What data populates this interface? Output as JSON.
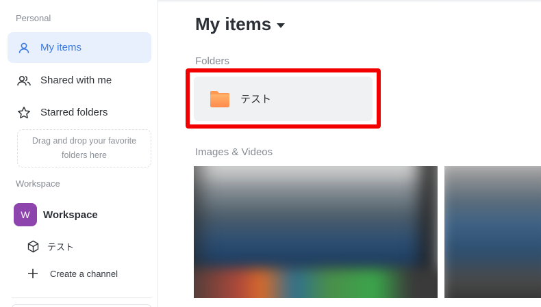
{
  "sidebar": {
    "personal_label": "Personal",
    "items": [
      {
        "label": "My items",
        "icon": "user-icon",
        "active": true
      },
      {
        "label": "Shared with me",
        "icon": "users-icon",
        "active": false
      },
      {
        "label": "Starred folders",
        "icon": "star-icon",
        "active": false
      }
    ],
    "drop_zone_text": "Drag and drop your favorite\nfolders here",
    "workspace_label": "Workspace",
    "workspace": {
      "avatar": "W",
      "name": "Workspace",
      "avatar_color": "#8e44ad"
    },
    "channels": [
      {
        "label": "テスト",
        "icon": "cube-icon"
      }
    ],
    "create_channel_label": "Create a channel"
  },
  "main": {
    "title": "My items",
    "folders_label": "Folders",
    "folders": [
      {
        "name": "テスト",
        "icon": "folder-icon",
        "color": "#ff9f5a"
      }
    ],
    "media_label": "Images & Videos",
    "highlight_color": "#f20000",
    "accent_color": "#3d7be0"
  }
}
